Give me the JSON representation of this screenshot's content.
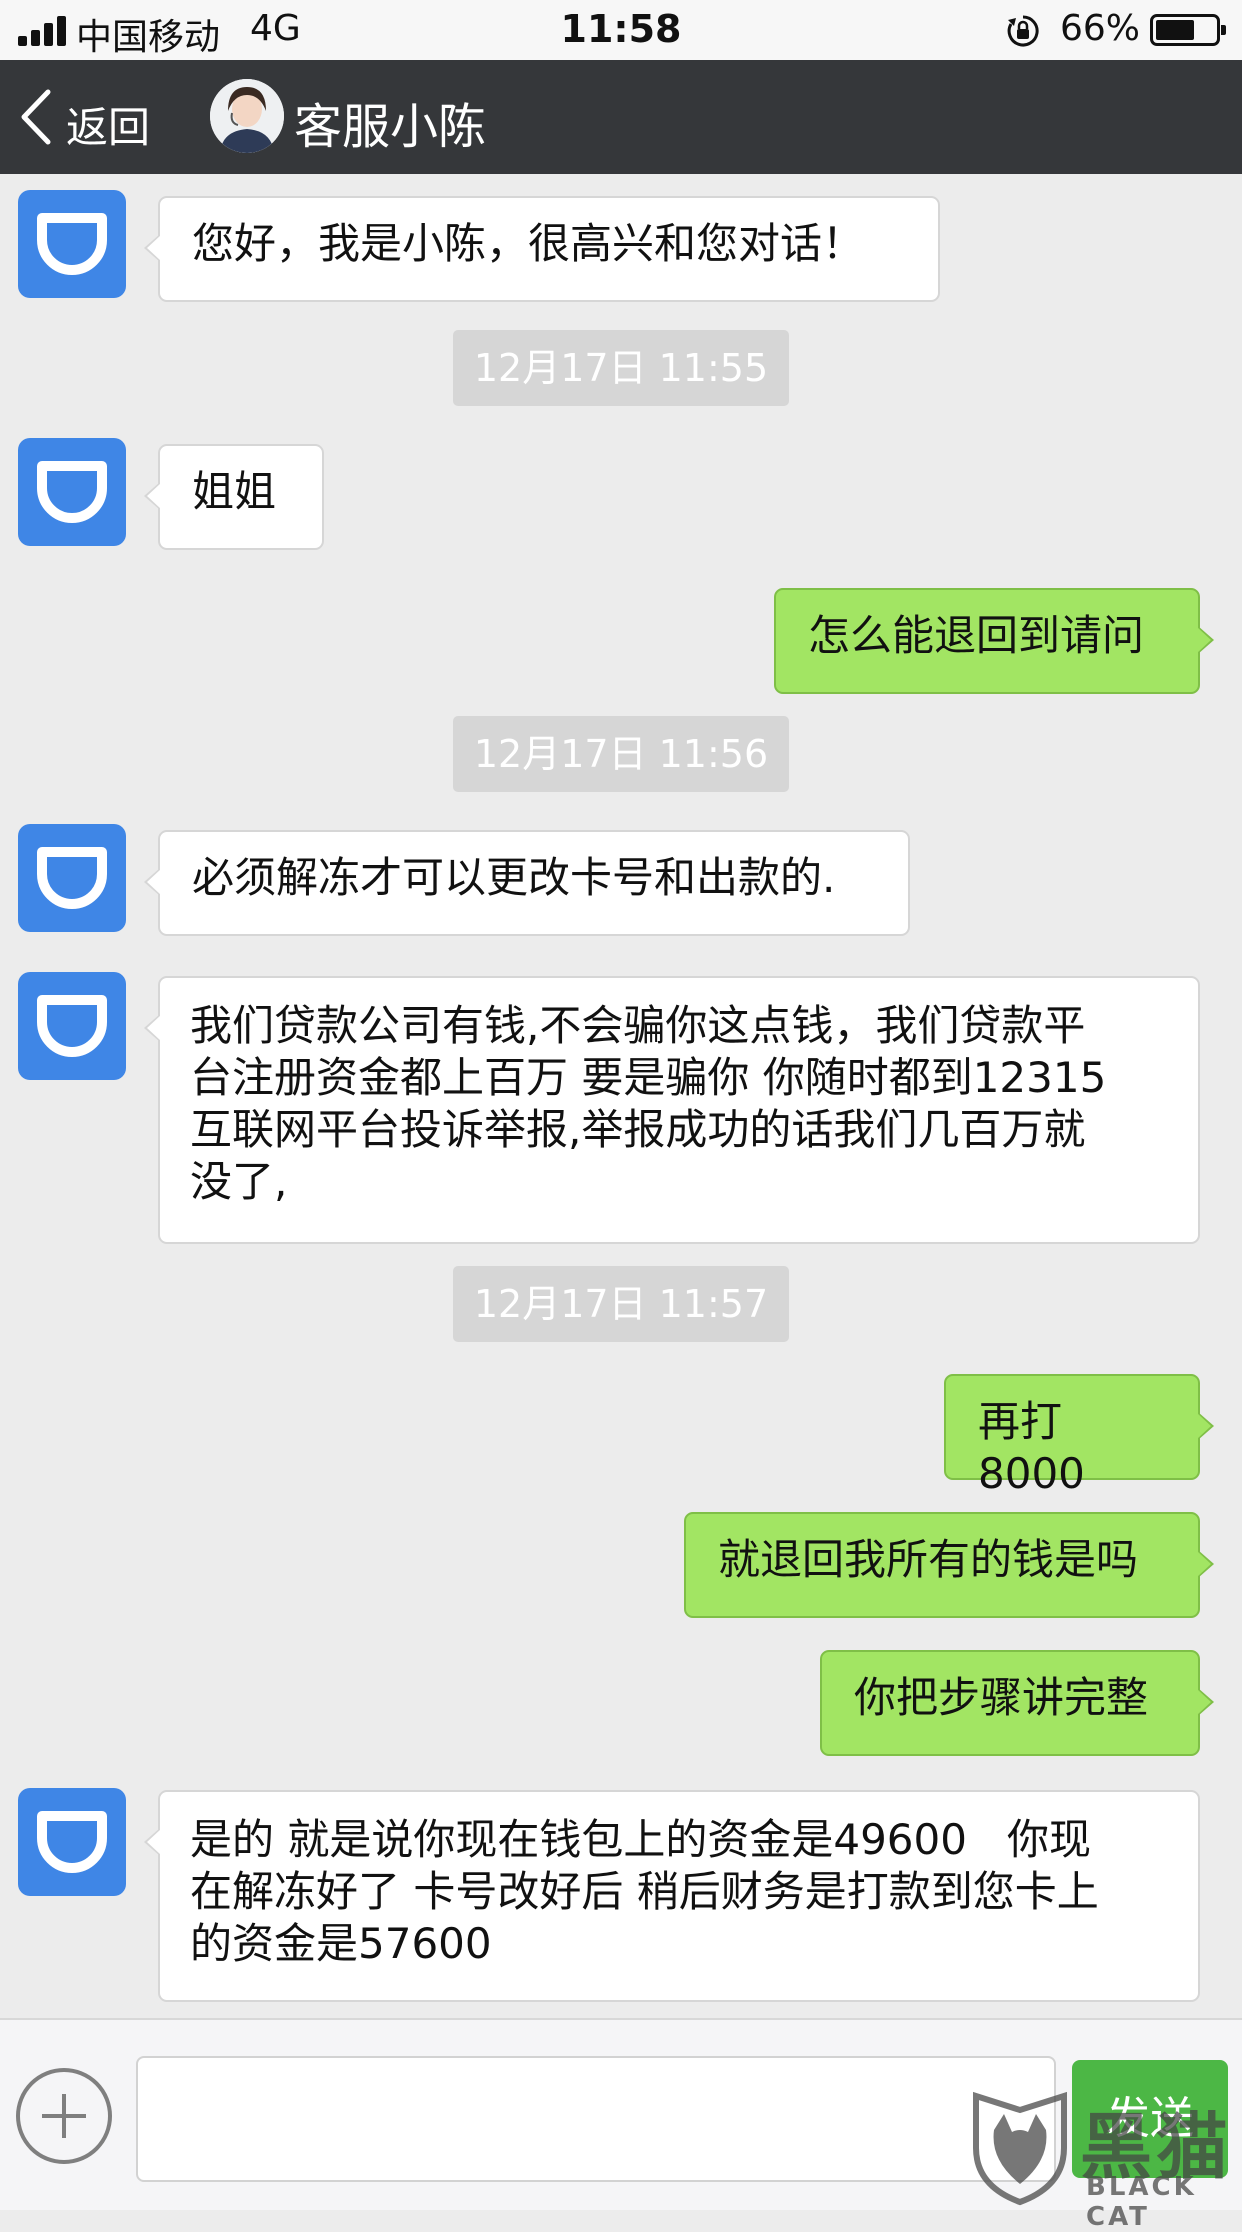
{
  "status_bar": {
    "carrier": "中国移动",
    "network": "4G",
    "time": "11:58",
    "battery_percent": "66%",
    "battery_level": 0.66
  },
  "nav": {
    "back_label": "返回",
    "title": "客服小陈"
  },
  "messages": [
    {
      "direction": "in",
      "text": "您好，我是小陈，很高兴和您对话！"
    },
    {
      "type": "timestamp",
      "text": "12月17日 11:55"
    },
    {
      "direction": "in",
      "text": "姐姐"
    },
    {
      "direction": "out",
      "text": "怎么能退回到请问"
    },
    {
      "type": "timestamp",
      "text": "12月17日 11:56"
    },
    {
      "direction": "in",
      "text": "必须解冻才可以更改卡号和出款的."
    },
    {
      "direction": "in",
      "text": "我们贷款公司有钱,不会骗你这点钱，我们贷款平\n台注册资金都上百万 要是骗你 你随时都到12315\n互联网平台投诉举报,举报成功的话我们几百万就\n没了,"
    },
    {
      "type": "timestamp",
      "text": "12月17日 11:57"
    },
    {
      "direction": "out",
      "text": "再打8000"
    },
    {
      "direction": "out",
      "text": "就退回我所有的钱是吗"
    },
    {
      "direction": "out",
      "text": "你把步骤讲完整"
    },
    {
      "direction": "in",
      "text": "是的 就是说你现在钱包上的资金是49600   你现\n在解冻好了 卡号改好后 稍后财务是打款到您卡上\n的资金是57600"
    }
  ],
  "input_bar": {
    "text_value": "",
    "send_label": "发送"
  },
  "watermark": {
    "cn": "黑猫",
    "en": "BLACK CAT"
  },
  "colors": {
    "nav_bg": "#35373a",
    "chat_bg": "#ececec",
    "outgoing_bubble": "#a2e563",
    "incoming_bubble": "#ffffff",
    "didi_blue": "#3f86e6",
    "send_button": "#4cb745"
  }
}
